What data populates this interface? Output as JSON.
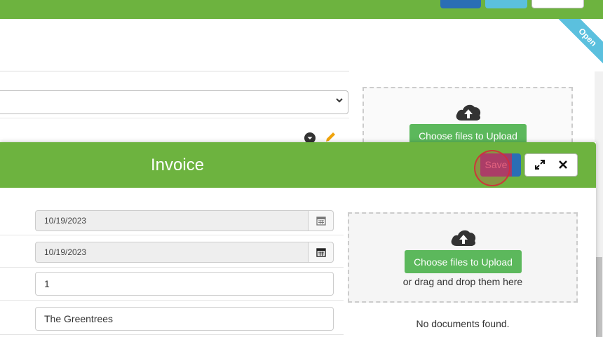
{
  "ribbon": {
    "label": "Open"
  },
  "background": {
    "upload_button_label": "Choose files to Upload"
  },
  "modal": {
    "title": "Invoice",
    "save_label": "Save",
    "expand_icon": "expand-icon",
    "close_icon": "close-icon",
    "fields": {
      "date_1": "10/19/2023",
      "date_2": "10/19/2023",
      "quantity": "1",
      "name": "The Greentrees"
    },
    "upload": {
      "button_label": "Choose files to Upload",
      "drag_hint": "or drag and drop them here",
      "icon": "cloud-upload-icon"
    },
    "no_documents": "No documents found."
  },
  "colors": {
    "header_green": "#6db33f",
    "primary_blue": "#2a6eb5",
    "info_blue": "#5bc0de",
    "success_green": "#5cb85c"
  }
}
